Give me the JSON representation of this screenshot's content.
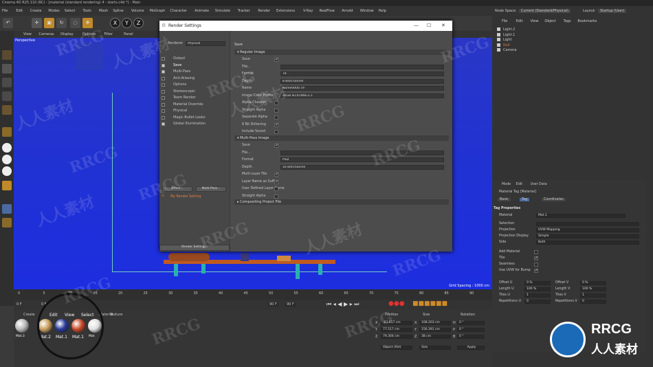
{
  "titlebar": {
    "title": "Cinema 4D R25.110 (RC) - [material (standard rendering) 4 - starts.c4d *] - Main"
  },
  "menu": [
    "File",
    "Edit",
    "Create",
    "Modes",
    "Select",
    "Tools",
    "Mesh",
    "Spline",
    "Volume",
    "MoGraph",
    "Character",
    "Animate",
    "Simulate",
    "Tracker",
    "Render",
    "Extensions",
    "V-Ray",
    "RealFlow",
    "Arnold",
    "Window",
    "Help"
  ],
  "nodespace": {
    "label": "Node Space:",
    "value": "Current (Standard/Physical)",
    "layout_label": "Layout:",
    "layout_value": "Startup (User)"
  },
  "viewport": {
    "menu": [
      "View",
      "Cameras",
      "Display",
      "Options",
      "Filter",
      "Panel"
    ],
    "label": "Perspective",
    "grid": "Grid Spacing : 1000 cm"
  },
  "toolbar": {
    "axis": [
      "X",
      "Y",
      "Z"
    ]
  },
  "dialog": {
    "title": "Render Settings",
    "renderer_label": "Renderer",
    "renderer_value": "Physical",
    "nav": [
      {
        "label": "Output",
        "checked": false
      },
      {
        "label": "Save",
        "checked": true
      },
      {
        "label": "Multi-Pass",
        "checked": true
      },
      {
        "label": "Anti-Aliasing",
        "checked": false
      },
      {
        "label": "Options",
        "checked": false
      },
      {
        "label": "Stereoscopic",
        "checked": false
      },
      {
        "label": "Team Render",
        "checked": false
      },
      {
        "label": "Material Override",
        "checked": false
      },
      {
        "label": "Physical",
        "checked": false
      },
      {
        "label": "Magic Bullet Looks",
        "checked": false
      },
      {
        "label": "Global Illumination",
        "checked": true
      }
    ],
    "effect_btn": "Effect...",
    "multipass_btn": "Multi-Pass...",
    "my_setting": "My Render Setting",
    "render_setting_btn": "Render Setting...",
    "save_header": "Save",
    "regular_header": "Regular Image",
    "regular": [
      {
        "label": "Save",
        "type": "check",
        "on": true
      },
      {
        "label": "File...",
        "type": "field",
        "value": ""
      },
      {
        "label": "Format",
        "type": "field",
        "value": "TIF"
      },
      {
        "label": "Depth",
        "type": "field",
        "value": "8 Bit/Channel"
      },
      {
        "label": "Name",
        "type": "field",
        "value": "Name0000.TIF"
      },
      {
        "label": "Image Color Profile",
        "type": "field",
        "value": "sRGB IEC61966-2.1"
      },
      {
        "label": "Alpha Channel",
        "type": "check",
        "on": false
      },
      {
        "label": "Straight Alpha",
        "type": "check",
        "on": false
      },
      {
        "label": "Separate Alpha",
        "type": "check",
        "on": false
      },
      {
        "label": "8 Bit Dithering",
        "type": "check",
        "on": true
      },
      {
        "label": "Include Sound",
        "type": "check",
        "on": false
      }
    ],
    "multi_header": "Multi-Pass Image",
    "multi": [
      {
        "label": "Save",
        "type": "check",
        "on": true
      },
      {
        "label": "File...",
        "type": "field",
        "value": ""
      },
      {
        "label": "Format",
        "type": "field",
        "value": "PSD"
      },
      {
        "label": "Depth",
        "type": "field",
        "value": "16 Bit/Channel"
      },
      {
        "label": "Multi-Layer File",
        "type": "check",
        "on": true
      },
      {
        "label": "Layer Name as Suffix",
        "type": "check",
        "on": true
      },
      {
        "label": "User Defined Layer Name",
        "type": "check",
        "on": false
      },
      {
        "label": "Straight Alpha",
        "type": "check",
        "on": false
      }
    ],
    "compositing_header": "Compositing Project File"
  },
  "objects": {
    "menu": [
      "File",
      "Edit",
      "View",
      "Object",
      "Tags",
      "Bookmarks"
    ],
    "items": [
      "Light.2",
      "Light.1",
      "Light",
      "Null",
      "Camera"
    ]
  },
  "attributes": {
    "menu": [
      "Mode",
      "Edit",
      "User Data"
    ],
    "title": "Material Tag [Material]",
    "tabs": [
      "Basic",
      "Tag",
      "Coordinates"
    ],
    "section": "Tag Properties",
    "material_label": "Material",
    "material_value": "Mat.1",
    "rows": [
      {
        "label": "Selection",
        "value": ""
      },
      {
        "label": "Projection",
        "value": "UVW Mapping"
      },
      {
        "label": "Projection Display",
        "value": "Simple"
      },
      {
        "label": "Side",
        "value": "Both"
      }
    ],
    "checks": [
      {
        "label": "Add Material",
        "on": false
      },
      {
        "label": "Tile",
        "on": true
      },
      {
        "label": "Seamless",
        "on": false
      },
      {
        "label": "Use UVW for Bump",
        "on": true
      }
    ],
    "pairs": [
      {
        "l1": "Offset U",
        "v1": "0 %",
        "l2": "Offset V",
        "v2": "0 %"
      },
      {
        "l1": "Length U",
        "v1": "100 %",
        "l2": "Length V",
        "v2": "100 %"
      },
      {
        "l1": "Tiles U",
        "v1": "1",
        "l2": "Tiles V",
        "v2": "1"
      },
      {
        "l1": "Repetitions U",
        "v1": "0",
        "l2": "Repetitions V",
        "v2": "0"
      }
    ]
  },
  "timeline": {
    "ticks": [
      "0",
      "5",
      "10",
      "15",
      "20",
      "25",
      "30",
      "35",
      "40",
      "45",
      "50",
      "55",
      "60",
      "65",
      "70",
      "75",
      "80",
      "85",
      "90"
    ],
    "frame": "0 F",
    "start": "0 F",
    "end": "90 F",
    "end2": "90 F"
  },
  "materials": {
    "menu": [
      "Create",
      "Edit",
      "View",
      "Select",
      "Material",
      "Texture"
    ],
    "items": [
      {
        "name": "Mat.3",
        "color": "#b8b8b8"
      },
      {
        "name": "Mat.2",
        "color": "#c8a060"
      },
      {
        "name": "Mat.1",
        "color": "#2a3a9a"
      },
      {
        "name": "Mat.1",
        "color": "#c84a2a"
      },
      {
        "name": "Mat",
        "color": "#e0e0e0"
      }
    ]
  },
  "coords": {
    "headers": [
      "Position",
      "Size",
      "Rotation"
    ],
    "rows": [
      {
        "a": "X",
        "pos": "-63.617 cm",
        "s": "X",
        "size": "108.203 cm",
        "r": "H",
        "rot": "0 °"
      },
      {
        "a": "Y",
        "pos": "77.517 cm",
        "s": "Y",
        "size": "156.391 cm",
        "r": "P",
        "rot": "0 °"
      },
      {
        "a": "Z",
        "pos": "79.304 cm",
        "s": "Z",
        "size": "38 cm",
        "r": "B",
        "rot": "0 °"
      }
    ],
    "mode1": "Object (Rel)",
    "mode2": "Size",
    "apply": "Apply"
  },
  "watermark": {
    "text1": "RRCG",
    "text2": "人人素材",
    "logo_cn": "人人素材",
    "logo_en": "RRCG"
  }
}
